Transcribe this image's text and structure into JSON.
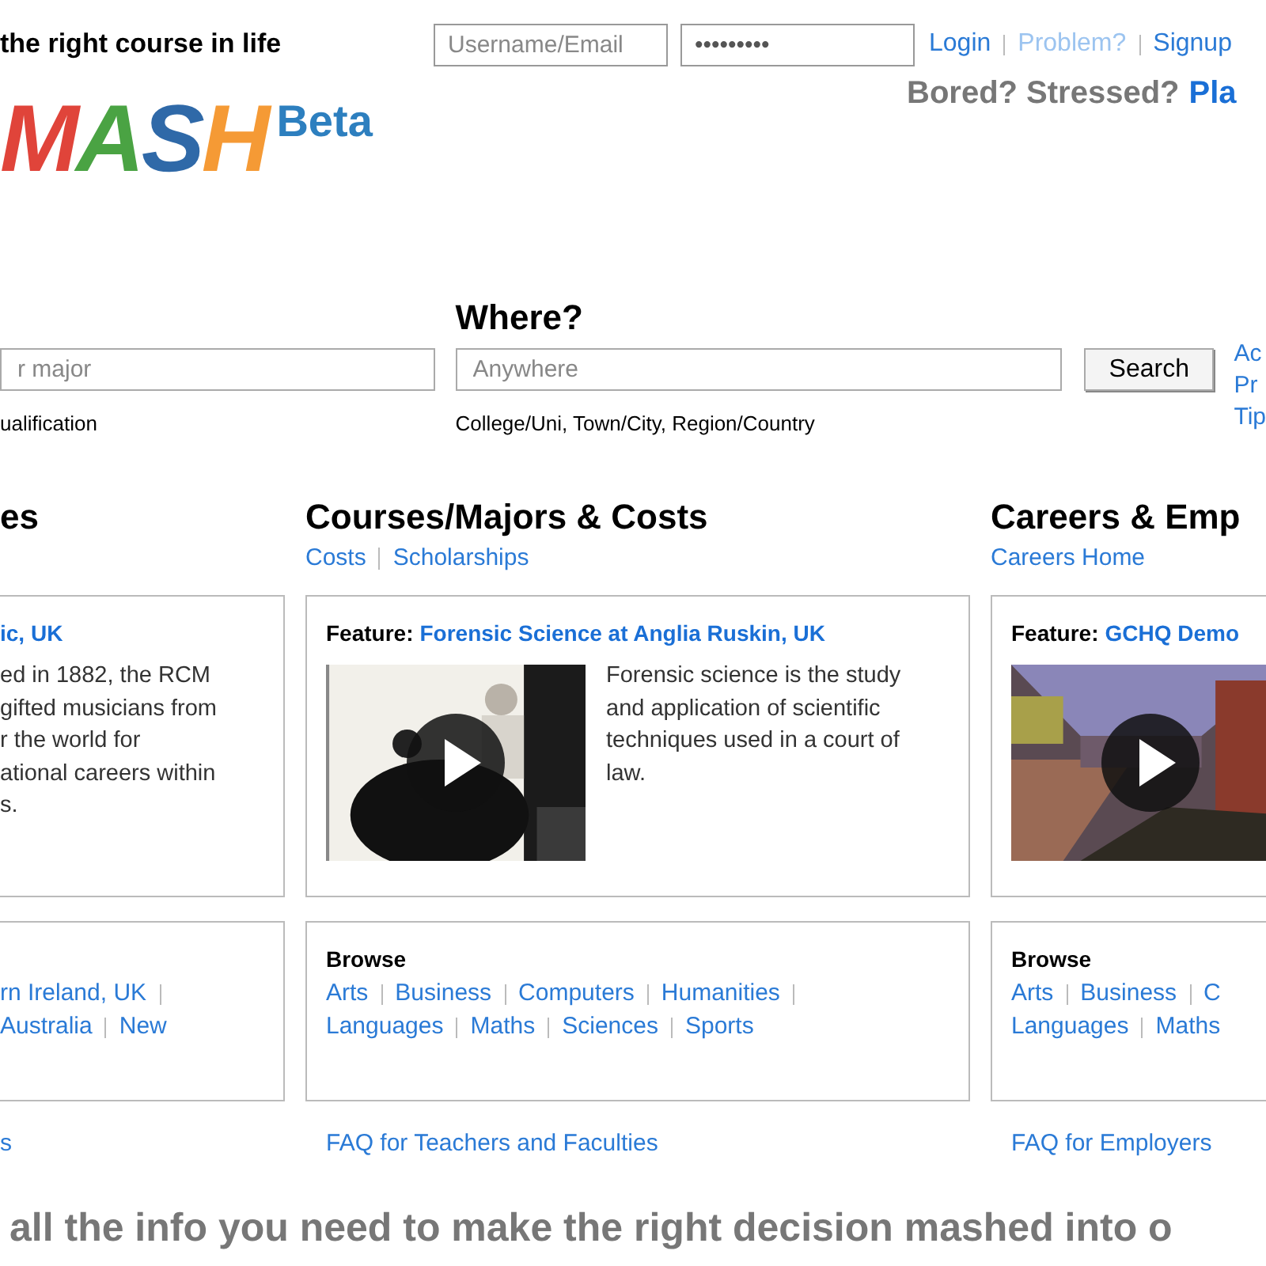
{
  "header": {
    "tagline": "the right course in life",
    "login": {
      "username_placeholder": "Username/Email",
      "password_value": "•••••••••",
      "links": [
        {
          "label": "Login",
          "muted": false
        },
        {
          "label": "Problem?",
          "muted": true
        },
        {
          "label": "Signup",
          "muted": false
        }
      ]
    },
    "promo": {
      "text": "Bored? Stressed?",
      "link": "Pla"
    }
  },
  "logo": {
    "letters": [
      {
        "char": "M",
        "color": "#e0443a"
      },
      {
        "char": "A",
        "color": "#4aa343"
      },
      {
        "char": "S",
        "color": "#2f69a8"
      },
      {
        "char": "H",
        "color": "#f59a35"
      }
    ],
    "badge": "Beta"
  },
  "search": {
    "fields": [
      {
        "placeholder": "r major",
        "hint": "ualification"
      },
      {
        "label": "Where?",
        "placeholder": "Anywhere",
        "hint": "College/Uni, Town/City, Region/Country"
      }
    ],
    "button": "Search",
    "side_links": [
      "Ac",
      "Pr",
      "Tip"
    ]
  },
  "columns": [
    {
      "heading": "es",
      "feature": {
        "title": "ic, UK",
        "text": "ed in 1882, the RCM\ngifted musicians from\nr the world for\national careers within\ns."
      },
      "browse": {
        "rows": [
          {
            "links": [
              "rn Ireland, UK"
            ],
            "trailing_divider": true
          },
          {
            "links": [
              "Australia",
              "New"
            ]
          }
        ]
      },
      "faq": "s"
    },
    {
      "heading": "Courses/Majors & Costs",
      "links": [
        "Costs",
        "Scholarships"
      ],
      "feature": {
        "prefix": "Feature:",
        "title": "Forensic Science at Anglia Ruskin, UK",
        "text": "Forensic science is the study\nand application of scientific\ntechniques used in a court of\nlaw."
      },
      "browse": {
        "heading": "Browse",
        "rows": [
          {
            "links": [
              "Arts",
              "Business",
              "Computers",
              "Humanities"
            ],
            "trailing_divider": true
          },
          {
            "links": [
              "Languages",
              "Maths",
              "Sciences",
              "Sports"
            ]
          }
        ]
      },
      "faq": "FAQ for Teachers and Faculties"
    },
    {
      "heading": "Careers & Emp",
      "links": [
        "Careers Home"
      ],
      "feature": {
        "prefix": "Feature:",
        "title": "GCHQ Demo"
      },
      "browse": {
        "heading": "Browse",
        "rows": [
          {
            "links": [
              "Arts",
              "Business",
              "C"
            ]
          },
          {
            "links": [
              "Languages",
              "Maths"
            ]
          }
        ]
      },
      "faq": "FAQ for Employers"
    }
  ],
  "footer_tagline": "all the info you need to make the right decision mashed into o"
}
